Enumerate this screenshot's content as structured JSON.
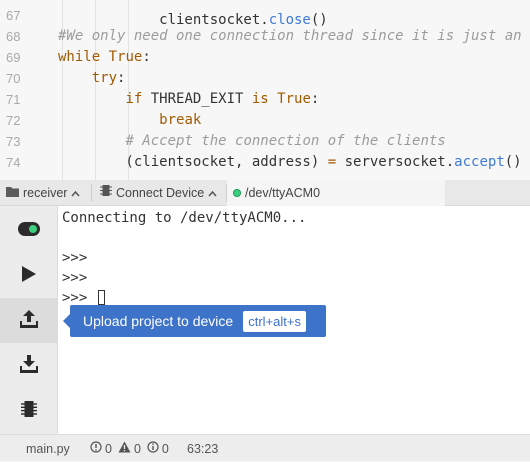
{
  "editor": {
    "lines": [
      {
        "num": "67",
        "parts": []
      },
      {
        "num": "68",
        "parts": [
          {
            "cls": "cmt",
            "text": "#We only need one connection thread since it is just an"
          }
        ]
      },
      {
        "num": "69",
        "parts": [
          {
            "cls": "kw",
            "text": "while"
          },
          {
            "cls": "",
            "text": " "
          },
          {
            "cls": "kw",
            "text": "True"
          },
          {
            "cls": "",
            "text": ":"
          }
        ]
      },
      {
        "num": "70",
        "parts": [
          {
            "cls": "",
            "text": "    "
          },
          {
            "cls": "kw",
            "text": "try"
          },
          {
            "cls": "",
            "text": ":"
          }
        ]
      },
      {
        "num": "71",
        "parts": [
          {
            "cls": "",
            "text": "        "
          },
          {
            "cls": "kw",
            "text": "if"
          },
          {
            "cls": "",
            "text": " THREAD_EXIT "
          },
          {
            "cls": "kw",
            "text": "is"
          },
          {
            "cls": "",
            "text": " "
          },
          {
            "cls": "kw",
            "text": "True"
          },
          {
            "cls": "",
            "text": ":"
          }
        ]
      },
      {
        "num": "72",
        "parts": [
          {
            "cls": "",
            "text": "            "
          },
          {
            "cls": "kw",
            "text": "break"
          }
        ]
      },
      {
        "num": "73",
        "parts": [
          {
            "cls": "",
            "text": "        "
          },
          {
            "cls": "cmt",
            "text": "# Accept the connection of the clients"
          }
        ]
      },
      {
        "num": "74",
        "parts": [
          {
            "cls": "",
            "text": "        (clientsocket, address) "
          },
          {
            "cls": "op",
            "text": "="
          },
          {
            "cls": "",
            "text": " serversocket."
          },
          {
            "cls": "fn",
            "text": "accept"
          },
          {
            "cls": "",
            "text": "()"
          }
        ]
      }
    ]
  },
  "tabs": {
    "receiver": {
      "label": "receiver",
      "icon": "folder-icon"
    },
    "connect": {
      "label": "Connect Device",
      "icon": "chip-icon"
    },
    "port": {
      "label": "/dev/ttyACM0",
      "status_color": "#3ccf7e"
    }
  },
  "rail": {
    "buttons": [
      {
        "name": "toggle-connection",
        "icon": "toggle-icon"
      },
      {
        "name": "run",
        "icon": "play-icon"
      },
      {
        "name": "upload",
        "icon": "upload-icon"
      },
      {
        "name": "download",
        "icon": "download-icon"
      },
      {
        "name": "device",
        "icon": "chip-icon"
      }
    ]
  },
  "terminal": {
    "connecting": "Connecting to /dev/ttyACM0...",
    "prompt": ">>>"
  },
  "tooltip": {
    "label": "Upload project to device",
    "shortcut": "ctrl+alt+s"
  },
  "statusbar": {
    "file": "main.py",
    "errors": "0",
    "warnings": "0",
    "infos": "0",
    "position": "63:23"
  },
  "colors": {
    "accent": "#3d73c9",
    "connected": "#3ccf7e",
    "keyword": "#a05a00",
    "function": "#3e7bd6"
  }
}
